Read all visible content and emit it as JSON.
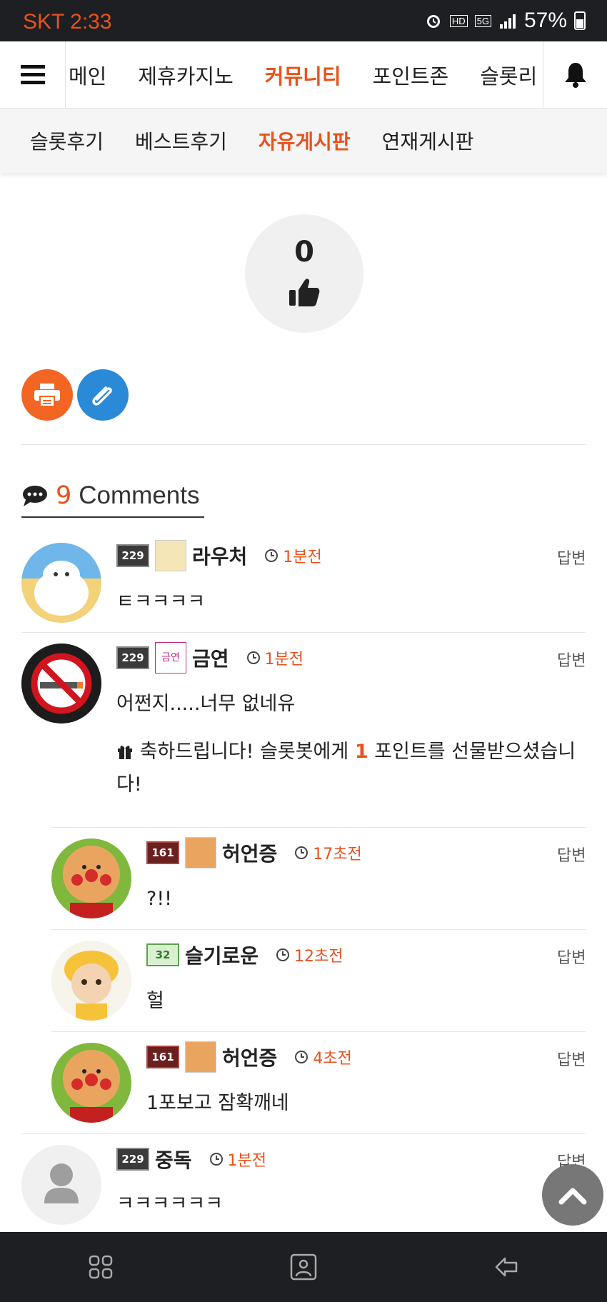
{
  "status": {
    "carrier_time": "SKT 2:33",
    "battery": "57%",
    "network": "5G",
    "hd": "HD"
  },
  "topnav": {
    "items": [
      {
        "label": "메인",
        "active": false
      },
      {
        "label": "제휴카지노",
        "active": false
      },
      {
        "label": "커뮤니티",
        "active": true
      },
      {
        "label": "포인트존",
        "active": false
      },
      {
        "label": "슬롯리",
        "active": false
      }
    ]
  },
  "subnav": {
    "items": [
      {
        "label": "슬롯후기",
        "active": false
      },
      {
        "label": "베스트후기",
        "active": false
      },
      {
        "label": "자유게시판",
        "active": true
      },
      {
        "label": "연재게시판",
        "active": false
      }
    ]
  },
  "like": {
    "count": "0"
  },
  "comments": {
    "count": "9",
    "label": "Comments",
    "reply_label": "답변",
    "items": [
      {
        "level": "229",
        "name": "라우처",
        "time": "1분전",
        "text": "ㅌㅋㅋㅋㅋ"
      },
      {
        "level": "229",
        "name": "금연",
        "mini_text": "금연",
        "time": "1분전",
        "text": "어쩐지.....너무 없네유",
        "gift_pre": "축하드립니다! 슬롯봇에게 ",
        "gift_points": "1",
        "gift_post": " 포인트를 선물받으셨습니다!"
      },
      {
        "level": "161",
        "name": "허언증",
        "time": "17초전",
        "text": "?!!"
      },
      {
        "level": "32",
        "name": "슬기로운",
        "time": "12초전",
        "text": "헐"
      },
      {
        "level": "161",
        "name": "허언증",
        "time": "4초전",
        "text": "1포보고 잠확깨네"
      },
      {
        "level": "229",
        "name": "중독",
        "time": "1분전",
        "text": "ㅋㅋㅋㅋㅋㅋ"
      }
    ]
  },
  "colors": {
    "accent": "#e8521d",
    "print": "#f26522",
    "link": "#2b8ad8",
    "status_bar": "#1e1f22"
  },
  "icons": [
    "menu-icon",
    "bell-icon",
    "thumbs-up-icon",
    "print-icon",
    "paperclip-icon",
    "comment-icon",
    "clock-icon",
    "gift-icon",
    "chevron-up-icon",
    "recent-apps-icon",
    "home-icon",
    "back-icon"
  ]
}
